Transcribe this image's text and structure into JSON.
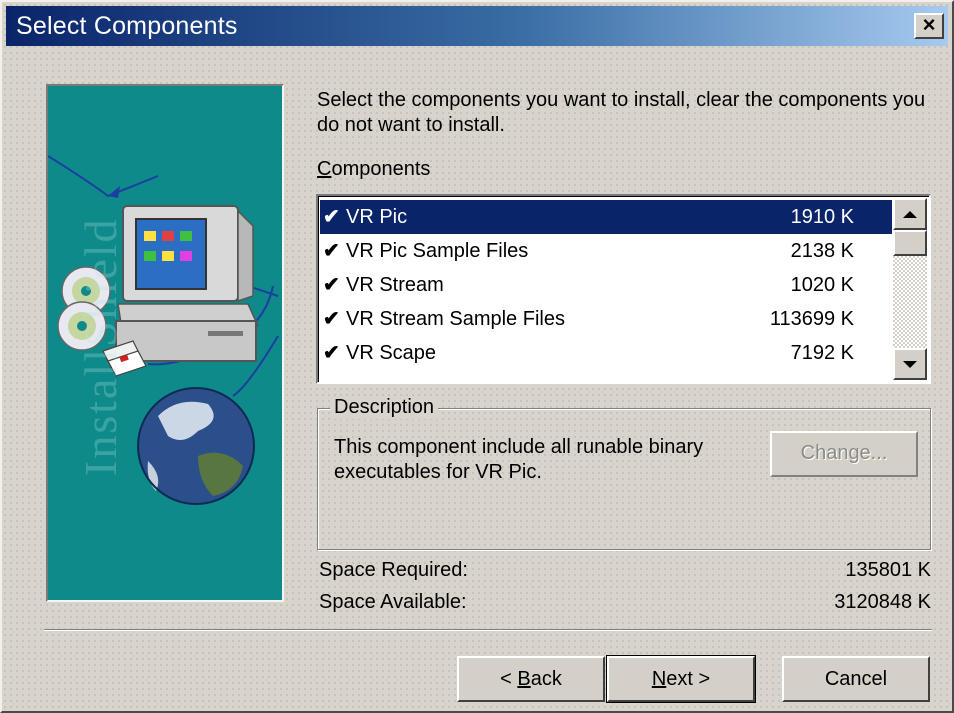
{
  "window": {
    "title": "Select Components",
    "close_glyph": "×"
  },
  "art_panel": {
    "brand_text": "InstallShield"
  },
  "intro_text": "Select the components you want to install, clear the components you do not want to install.",
  "components": {
    "label_mnemonic": "C",
    "label_rest": "omponents",
    "items": [
      {
        "name": "VR Pic",
        "size": "1910 K",
        "checked": true,
        "selected": true
      },
      {
        "name": "VR Pic Sample Files",
        "size": "2138 K",
        "checked": true,
        "selected": false
      },
      {
        "name": "VR Stream",
        "size": "1020 K",
        "checked": true,
        "selected": false
      },
      {
        "name": "VR Stream Sample Files",
        "size": "113699 K",
        "checked": true,
        "selected": false
      },
      {
        "name": "VR Scape",
        "size": "7192 K",
        "checked": true,
        "selected": false
      }
    ],
    "check_glyph": "✔"
  },
  "description": {
    "legend": "Description",
    "text": "This component include all runable binary executables for VR Pic.",
    "change_button": "Change..."
  },
  "space": {
    "required_label": "Space Required:",
    "required_value": "135801 K",
    "available_label": "Space Available:",
    "available_value": "3120848 K"
  },
  "buttons": {
    "back_prefix": "< ",
    "back_mnemonic": "B",
    "back_rest": "ack",
    "next_mnemonic": "N",
    "next_rest": "ext >",
    "cancel": "Cancel"
  },
  "colors": {
    "selection": "#0a246a",
    "art_background": "#0f8a8a",
    "dialog_face": "#d4d0c8"
  }
}
